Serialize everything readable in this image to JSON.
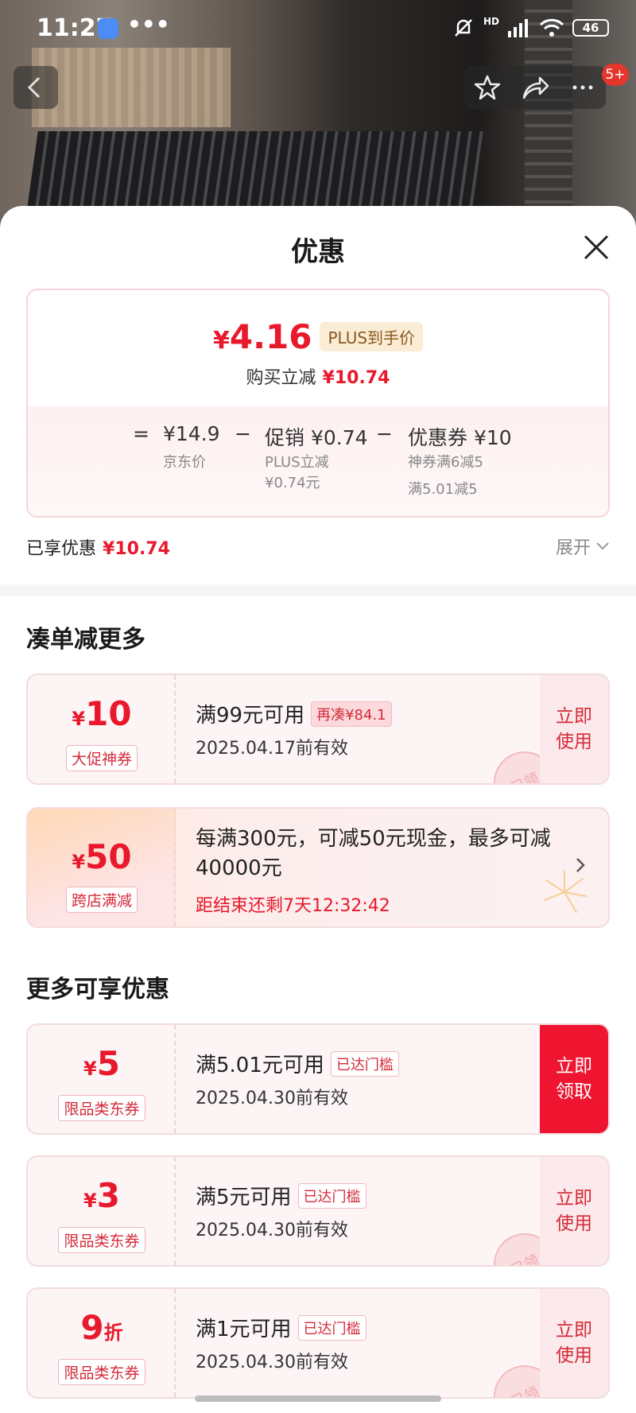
{
  "status": {
    "time": "11:27",
    "dots": "•••",
    "signal_label": "HD",
    "battery": "46"
  },
  "nav": {
    "badge": "5+"
  },
  "sheet": {
    "title": "优惠"
  },
  "price_card": {
    "currency": "¥",
    "final_price": "4.16",
    "plus_tag": "PLUS到手价",
    "instant_label": "购买立减",
    "instant_value": "¥10.74",
    "equals": "=",
    "jd_price": "¥14.9",
    "jd_price_label": "京东价",
    "minus1": "−",
    "promo_value": "促销 ¥0.74",
    "promo_note1": "PLUS立减",
    "promo_note2": "¥0.74元",
    "minus2": "−",
    "coupon_value": "优惠券 ¥10",
    "coupon_note1": "神券满6减5",
    "coupon_note2": "满5.01减5"
  },
  "enjoyed": {
    "label": "已享优惠",
    "value": "¥10.74",
    "expand": "展开"
  },
  "section1": {
    "title": "凑单减更多"
  },
  "coupon1": {
    "currency": "¥",
    "amount": "10",
    "tag": "大促神券",
    "condition": "满99元可用",
    "chip": "再凑¥84.1",
    "valid": "2025.04.17前有效",
    "action": "立即\n使用",
    "stamp": "已领"
  },
  "promo": {
    "currency": "¥",
    "amount": "50",
    "tag": "跨店满减",
    "desc": "每满300元，可减50元现金，最多可减40000元",
    "countdown": "距结束还剩7天12:32:42"
  },
  "section2": {
    "title": "更多可享优惠"
  },
  "coupon2": {
    "currency": "¥",
    "amount": "5",
    "tag": "限品类东券",
    "condition": "满5.01元可用",
    "chip": "已达门槛",
    "valid": "2025.04.30前有效",
    "action": "立即\n领取"
  },
  "coupon3": {
    "currency": "¥",
    "amount": "3",
    "tag": "限品类东券",
    "condition": "满5元可用",
    "chip": "已达门槛",
    "valid": "2025.04.30前有效",
    "action": "立即\n使用",
    "stamp": "已领"
  },
  "coupon4": {
    "amount": "9",
    "unit": "折",
    "tag": "限品类东券",
    "condition": "满1元可用",
    "chip": "已达门槛",
    "valid": "2025.04.30前有效",
    "action": "立即\n使用",
    "stamp": "已领"
  },
  "colors": {
    "accent_red": "#e8192c",
    "solid_button": "#ef1530"
  }
}
